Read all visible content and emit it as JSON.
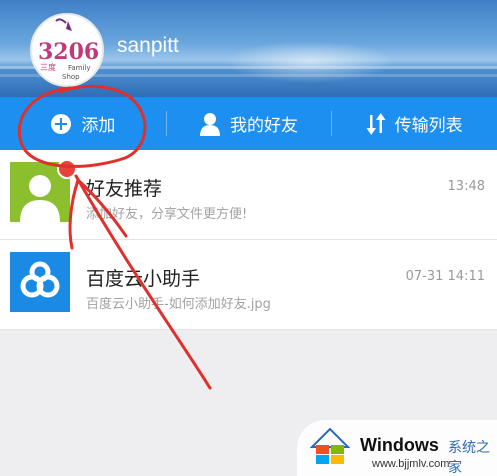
{
  "header": {
    "username": "sanpitt",
    "avatar_logo_texts": [
      "3206",
      "三度",
      "Family",
      "Shop"
    ]
  },
  "tabs": [
    {
      "label": "添加",
      "icon": "plus-circle-icon"
    },
    {
      "label": "我的好友",
      "icon": "person-icon"
    },
    {
      "label": "传输列表",
      "icon": "transfer-arrows-icon"
    }
  ],
  "messages": [
    {
      "title": "好友推荐",
      "subtitle": "添加好友，分享文件更方便!",
      "time": "13:48",
      "icon": "default-avatar-icon",
      "badge": true
    },
    {
      "title": "百度云小助手",
      "subtitle": "百度云小助手-如何添加好友.jpg",
      "time": "07-31 14:11",
      "icon": "baidu-cloud-icon",
      "badge": false
    }
  ],
  "watermark": {
    "brand": "Windows",
    "brand_cn": "系统之家",
    "url": "www.bjjmlv.com"
  },
  "colors": {
    "tabbar": "#1c8ff0",
    "recommend_icon_bg": "#8bbf2e",
    "assistant_icon_bg": "#1a8ae5",
    "badge": "#e5433b",
    "annotation_red": "#e0302c"
  }
}
